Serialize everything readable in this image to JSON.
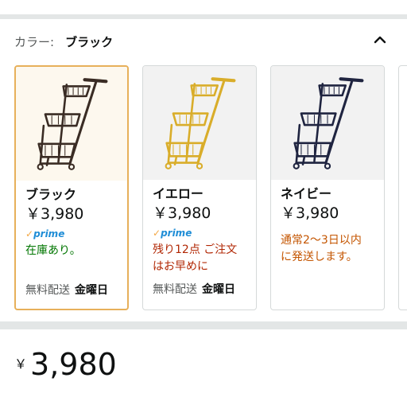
{
  "color_selector": {
    "label": "カラー:",
    "selected_value": "ブラック"
  },
  "options": [
    {
      "name": "ブラック",
      "price": "￥3,980",
      "prime_check": "✓",
      "prime_word": "prime",
      "stock_text": "在庫あり。",
      "delivery_label": "無料配送",
      "delivery_day": "金曜日",
      "cart_color": "#3a2c24",
      "selected": true
    },
    {
      "name": "イエロー",
      "price": "￥3,980",
      "prime_check": "✓",
      "prime_word": "prime",
      "stock_line1": "残り12点 ご注文",
      "stock_line2": "はお早めに",
      "delivery_label": "無料配送",
      "delivery_day": "金曜日",
      "cart_color": "#d9ad2a",
      "selected": false
    },
    {
      "name": "ネイビー",
      "price": "￥3,980",
      "ship_line1": "通常2～3日以内",
      "ship_line2": "に発送します。",
      "cart_color": "#1f2440",
      "selected": false
    }
  ],
  "price_summary": {
    "currency_symbol": "￥",
    "amount": "3,980"
  },
  "colors": {
    "selected_border": "#e7b05a",
    "prime_blue": "#1f8dd6",
    "in_stock": "#007600",
    "low_stock": "#b12704",
    "shipping": "#c45500"
  }
}
